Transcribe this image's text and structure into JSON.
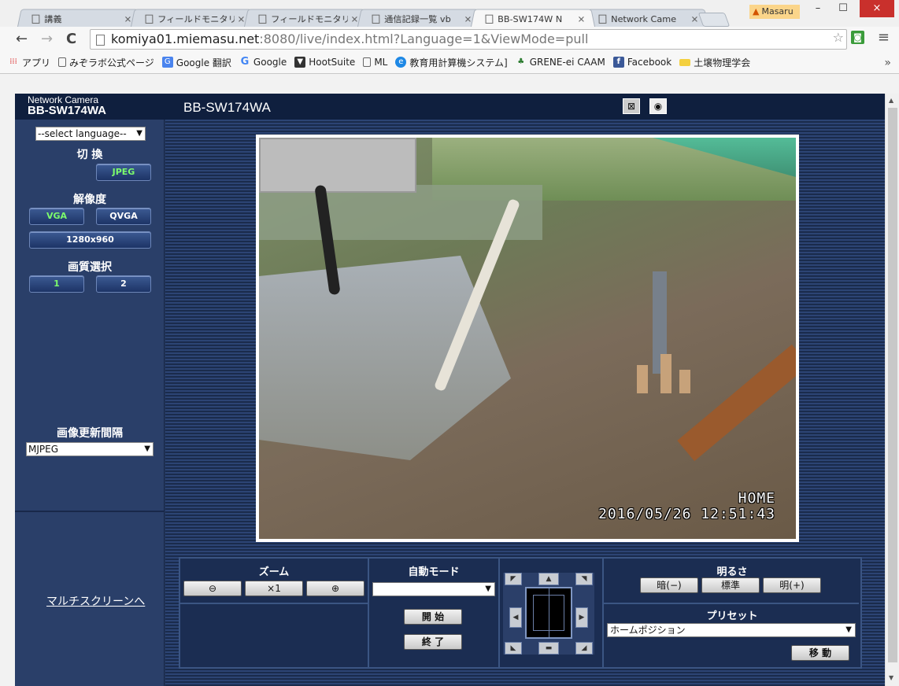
{
  "window": {
    "user": "Masaru",
    "minimize": "–",
    "maximize": "☐",
    "close": "×"
  },
  "tabs": [
    {
      "label": "講義",
      "active": false
    },
    {
      "label": "フィールドモニタリン",
      "active": false
    },
    {
      "label": "フィールドモニタリン",
      "active": false
    },
    {
      "label": "通信記録一覧 vb",
      "active": false
    },
    {
      "label": "BB-SW174W N",
      "active": true
    },
    {
      "label": "Network Came",
      "active": false
    }
  ],
  "toolbar": {
    "back": "←",
    "forward": "→",
    "reload": "C",
    "url_host": "komiya01.miemasu.net",
    "url_rest": ":8080/live/index.html?Language=1&ViewMode=pull",
    "star": "☆",
    "menu": "≡"
  },
  "bookmarks": [
    {
      "label": "アプリ",
      "icon": "apps-icon"
    },
    {
      "label": "みぞラボ公式ページ",
      "icon": "page-icon"
    },
    {
      "label": "Google 翻訳",
      "icon": "translate-icon"
    },
    {
      "label": "Google",
      "icon": "google-icon"
    },
    {
      "label": "HootSuite",
      "icon": "hootsuite-icon"
    },
    {
      "label": "ML",
      "icon": "page-icon"
    },
    {
      "label": "教育用計算機システム]",
      "icon": "ie-icon"
    },
    {
      "label": "GRENE-ei CAAM",
      "icon": "tree-icon"
    },
    {
      "label": "Facebook",
      "icon": "facebook-icon"
    },
    {
      "label": "土壌物理学会",
      "icon": "folder-icon"
    }
  ],
  "bookmarks_more": "»",
  "camera": {
    "brand_line1": "Network Camera",
    "brand_line2": "BB-SW174WA",
    "title": "BB-SW174WA",
    "language_select": "--select language--",
    "switch_label": "切 換",
    "jpeg_button": "JPEG",
    "resolution_label": "解像度",
    "vga_button": "VGA",
    "qvga_button": "QVGA",
    "res1280_button": "1280x960",
    "quality_label": "画質選択",
    "quality1_button": "1",
    "quality2_button": "2",
    "refresh_label": "画像更新間隔",
    "refresh_select": "MJPEG",
    "multiscreen_link": "マルチスクリーンへ",
    "osd_home": "HOME",
    "osd_datetime": "2016/05/26  12:51:43"
  },
  "controls": {
    "zoom_title": "ズーム",
    "zoom_out": "⊖",
    "zoom_reset": "×1",
    "zoom_in": "⊕",
    "auto_title": "自動モード",
    "auto_select": "",
    "auto_start": "開 始",
    "auto_stop": "終 了",
    "brightness_title": "明るさ",
    "bright_dark": "暗(−)",
    "bright_std": "標準",
    "bright_light": "明(+)",
    "preset_title": "プリセット",
    "preset_select": "ホームポジション",
    "preset_go": "移 動"
  }
}
